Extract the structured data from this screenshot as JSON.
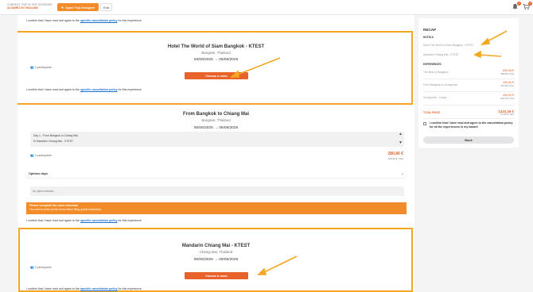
{
  "header": {
    "trip_line": "CURRENT TRIP IN TRIP DESIGNER",
    "trip_dest": "ALSAMEZ IN THAILAND",
    "designer_label": "Open Trip Designer",
    "exit_label": "Exit",
    "bell_icon": "bell-icon",
    "cart_icon": "cart-icon",
    "bell_count": "1",
    "cart_count": "3"
  },
  "confirm": {
    "prefix": "I confirm that I have read and agree to the",
    "link": "specific cancellation policy",
    "suffix": "for this experience"
  },
  "hotel1": {
    "name": "Hotel The World of Siam Bangkok - KTEST",
    "city": "Bangkok, Thailand",
    "date_from": "03/06/2025",
    "date_to": "06/06/2025",
    "participants": "2 participants",
    "button": "Choose a room"
  },
  "transfer": {
    "name": "From Bangkok to Chiang Mai",
    "city": "Bangkok, Thailand",
    "date_from": "06/06/2025",
    "date_to": "06/06/2025",
    "day_line": "Day 1 - From Bangkok to Chiang Mai",
    "day_sub": "Mandarin Chiang Mai - KTEST",
    "participants": "2 participants",
    "price": "280,80 €",
    "price_sub": "140,40 € / Pax",
    "options_label": "Options days",
    "no_option": "No option selected",
    "alert_title": "Please complete the room selection",
    "alert_text": "You need to select all the rooms before filling guests information."
  },
  "hotel2": {
    "name": "Mandarin Chiang Mai - KTEST",
    "city": "Chiang Mai, Thailand",
    "date_from": "06/06/2025",
    "date_to": "09/06/2025",
    "participants": "2 participants",
    "button": "Choose a room"
  },
  "recap": {
    "title": "RECAP",
    "hotels_label": "HOTELS",
    "hotels": [
      "Hotel The World of Siam Bangkok - KTEST",
      "Mandarin Chiang Mai - KTEST"
    ],
    "experiences_label": "EXPERIENCES",
    "experiences": [
      {
        "name": "The Best of Bangkok !",
        "price": "656,96 €",
        "sub": "328,48 € / Pax"
      },
      {
        "name": "From Bangkok to Chiang Mai",
        "price": "280,80 €",
        "sub": "140,40 € / Pax"
      },
      {
        "name": "Chiang Mai - 3 days",
        "price": "405,50 €",
        "sub": "202,75 € / Pax"
      }
    ],
    "total_label": "TOTAL PRICE",
    "total_price": "1343,26 €",
    "total_sub": "771,63 € / PAX",
    "confirm_text": "I confirm that I have read and agree to the cancellation policy for all the experiences in my basket",
    "book_label": "Book"
  },
  "colors": {
    "accent": "#e8622c",
    "highlight": "#f5a623",
    "link": "#1a6fd0"
  }
}
